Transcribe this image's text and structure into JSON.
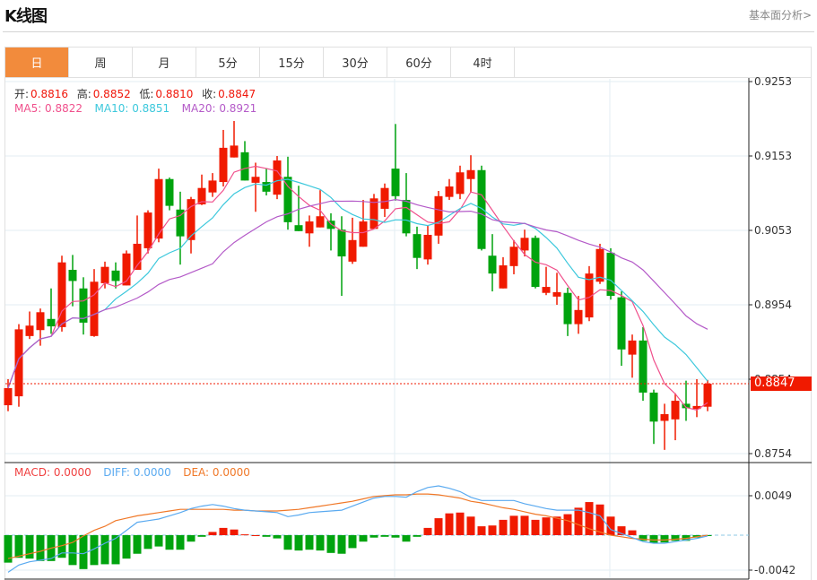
{
  "header": {
    "title": "K线图",
    "more_link": "基本面分析>"
  },
  "tabs": [
    {
      "label": "日",
      "active": true
    },
    {
      "label": "周"
    },
    {
      "label": "月"
    },
    {
      "label": "5分"
    },
    {
      "label": "15分"
    },
    {
      "label": "30分"
    },
    {
      "label": "60分"
    },
    {
      "label": "4时"
    }
  ],
  "ohlc_info": {
    "open_label": "开:",
    "open": "0.8816",
    "high_label": "高:",
    "high": "0.8852",
    "low_label": "低:",
    "low": "0.8810",
    "close_label": "收:",
    "close": "0.8847"
  },
  "ma_info": {
    "ma5": "MA5: 0.8822",
    "ma10": "MA10: 0.8851",
    "ma20": "MA20: 0.8921"
  },
  "macd_info": {
    "macd": "MACD: 0.0000",
    "diff": "DIFF: 0.0000",
    "dea": "DEA: 0.0000"
  },
  "colors": {
    "up": "#f01a00",
    "down": "#00a30e",
    "ma5": "#f0508c",
    "ma10": "#3cc8dc",
    "ma20": "#b45ac8",
    "diff": "#5aaaf0",
    "dea": "#f07828",
    "accent": "#f28b3c"
  },
  "price_axis": {
    "ticks": [
      "0.9253",
      "0.9153",
      "0.9053",
      "0.8954",
      "0.8854",
      "0.8754"
    ],
    "current": "0.8847"
  },
  "macd_axis": {
    "ticks": [
      "0.0049",
      "-0.0042"
    ]
  },
  "chart_data": {
    "type": "candlestick",
    "price_range": [
      0.8754,
      0.9253
    ],
    "macd_range": [
      -0.0042,
      0.0049
    ],
    "candles": [
      [
        0.8818,
        0.8853,
        0.881,
        0.8841
      ],
      [
        0.883,
        0.8927,
        0.8816,
        0.892
      ],
      [
        0.8911,
        0.8944,
        0.8907,
        0.8925
      ],
      [
        0.8919,
        0.8948,
        0.8898,
        0.8943
      ],
      [
        0.8934,
        0.8975,
        0.8914,
        0.8924
      ],
      [
        0.8923,
        0.9019,
        0.8917,
        0.901
      ],
      [
        0.9,
        0.902,
        0.8951,
        0.8985
      ],
      [
        0.8975,
        0.899,
        0.8913,
        0.8929
      ],
      [
        0.8911,
        0.9001,
        0.891,
        0.8984
      ],
      [
        0.8982,
        0.9011,
        0.8975,
        0.9004
      ],
      [
        0.8999,
        0.901,
        0.8975,
        0.8985
      ],
      [
        0.8979,
        0.9026,
        0.8979,
        0.9022
      ],
      [
        0.9,
        0.9073,
        0.9,
        0.9035
      ],
      [
        0.9029,
        0.908,
        0.9022,
        0.9077
      ],
      [
        0.9042,
        0.9136,
        0.9037,
        0.9122
      ],
      [
        0.9122,
        0.9124,
        0.908,
        0.9086
      ],
      [
        0.9081,
        0.9105,
        0.9007,
        0.9045
      ],
      [
        0.904,
        0.9098,
        0.9022,
        0.9095
      ],
      [
        0.9088,
        0.9128,
        0.9087,
        0.911
      ],
      [
        0.9104,
        0.913,
        0.9098,
        0.912
      ],
      [
        0.9118,
        0.9188,
        0.9112,
        0.9164
      ],
      [
        0.9151,
        0.92,
        0.9151,
        0.9167
      ],
      [
        0.9158,
        0.9173,
        0.912,
        0.912
      ],
      [
        0.9117,
        0.9144,
        0.9078,
        0.9125
      ],
      [
        0.9118,
        0.9136,
        0.91,
        0.9105
      ],
      [
        0.9101,
        0.9153,
        0.9095,
        0.9147
      ],
      [
        0.9125,
        0.9152,
        0.9054,
        0.9064
      ],
      [
        0.906,
        0.9113,
        0.9052,
        0.9052
      ],
      [
        0.9049,
        0.9073,
        0.9031,
        0.9065
      ],
      [
        0.9057,
        0.9107,
        0.9057,
        0.9072
      ],
      [
        0.9066,
        0.9076,
        0.9026,
        0.9055
      ],
      [
        0.9054,
        0.9072,
        0.8965,
        0.9018
      ],
      [
        0.9011,
        0.907,
        0.9008,
        0.904
      ],
      [
        0.9031,
        0.9094,
        0.9031,
        0.9065
      ],
      [
        0.9055,
        0.9102,
        0.9055,
        0.9096
      ],
      [
        0.9082,
        0.9116,
        0.9071,
        0.911
      ],
      [
        0.9136,
        0.9196,
        0.9093,
        0.9099
      ],
      [
        0.9094,
        0.913,
        0.9045,
        0.9049
      ],
      [
        0.9048,
        0.9058,
        0.9001,
        0.9016
      ],
      [
        0.9014,
        0.906,
        0.9007,
        0.9047
      ],
      [
        0.9046,
        0.9106,
        0.9035,
        0.9099
      ],
      [
        0.9098,
        0.9122,
        0.9094,
        0.9112
      ],
      [
        0.9102,
        0.914,
        0.9095,
        0.9131
      ],
      [
        0.9122,
        0.9154,
        0.9104,
        0.9134
      ],
      [
        0.9134,
        0.914,
        0.9026,
        0.9028
      ],
      [
        0.9019,
        0.9048,
        0.8971,
        0.8995
      ],
      [
        0.8975,
        0.9017,
        0.8975,
        0.9006
      ],
      [
        0.9005,
        0.904,
        0.8994,
        0.9031
      ],
      [
        0.9026,
        0.9054,
        0.9018,
        0.9043
      ],
      [
        0.9043,
        0.9046,
        0.8975,
        0.8977
      ],
      [
        0.8969,
        0.9004,
        0.8966,
        0.8977
      ],
      [
        0.8964,
        0.8996,
        0.8953,
        0.897
      ],
      [
        0.8969,
        0.8976,
        0.8911,
        0.8927
      ],
      [
        0.8927,
        0.8965,
        0.8914,
        0.8946
      ],
      [
        0.8936,
        0.9005,
        0.8931,
        0.8995
      ],
      [
        0.8984,
        0.9035,
        0.8981,
        0.9028
      ],
      [
        0.9023,
        0.9029,
        0.896,
        0.8965
      ],
      [
        0.8963,
        0.8971,
        0.8871,
        0.8893
      ],
      [
        0.8886,
        0.8913,
        0.8855,
        0.8905
      ],
      [
        0.8905,
        0.8923,
        0.8824,
        0.8835
      ],
      [
        0.8835,
        0.8839,
        0.8766,
        0.8796
      ],
      [
        0.8797,
        0.882,
        0.8758,
        0.8806
      ],
      [
        0.8799,
        0.8834,
        0.8771,
        0.8824
      ],
      [
        0.882,
        0.8851,
        0.8797,
        0.8814
      ],
      [
        0.8813,
        0.8853,
        0.8802,
        0.8817
      ],
      [
        0.8816,
        0.8852,
        0.881,
        0.8847
      ]
    ],
    "macd_hist": [
      -0.0034,
      -0.0028,
      -0.0029,
      -0.0032,
      -0.0032,
      -0.0028,
      -0.0037,
      -0.0042,
      -0.0037,
      -0.0036,
      -0.0036,
      -0.0029,
      -0.0023,
      -0.0017,
      -0.0014,
      -0.0018,
      -0.0018,
      -0.0008,
      -0.0002,
      0.0004,
      0.0009,
      0.0007,
      0.0001,
      0.0,
      -0.0002,
      -0.0004,
      -0.0018,
      -0.0019,
      -0.0018,
      -0.0019,
      -0.0022,
      -0.0023,
      -0.0016,
      -0.0008,
      -0.0003,
      -0.0002,
      -0.0003,
      -0.0008,
      -0.0002,
      0.0009,
      0.0021,
      0.0027,
      0.0028,
      0.0023,
      0.0011,
      0.0012,
      0.0019,
      0.0024,
      0.0024,
      0.0019,
      0.0022,
      0.0023,
      0.0026,
      0.0034,
      0.0041,
      0.0038,
      0.0023,
      0.0011,
      0.0006,
      -0.0007,
      -0.001,
      -0.0009,
      -0.0007,
      -0.0007,
      -0.0003,
      -0.0001
    ],
    "diff": [
      -0.0046,
      -0.0037,
      -0.0033,
      -0.0031,
      -0.0029,
      -0.0022,
      -0.0022,
      -0.0023,
      -0.0017,
      -0.001,
      -0.0004,
      0.0006,
      0.0016,
      0.0018,
      0.002,
      0.0024,
      0.0028,
      0.0033,
      0.0036,
      0.0038,
      0.0036,
      0.0033,
      0.0031,
      0.003,
      0.0029,
      0.0028,
      0.0023,
      0.0025,
      0.0028,
      0.0029,
      0.003,
      0.0031,
      0.0036,
      0.0041,
      0.0046,
      0.0048,
      0.0048,
      0.0047,
      0.0054,
      0.0059,
      0.0061,
      0.0058,
      0.0054,
      0.0047,
      0.0043,
      0.0043,
      0.0043,
      0.0043,
      0.0039,
      0.0036,
      0.0033,
      0.0031,
      0.0031,
      0.0031,
      0.0028,
      0.0024,
      0.0007,
      0.0002,
      -0.0003,
      -0.0008,
      -0.001,
      -0.001,
      -0.0008,
      -0.0006,
      -0.0004,
      -0.0001
    ],
    "dea": [
      -0.0029,
      -0.0026,
      -0.0023,
      -0.002,
      -0.0016,
      -0.0013,
      -0.0009,
      -0.0001,
      0.0006,
      0.0011,
      0.0018,
      0.0021,
      0.0024,
      0.0026,
      0.0028,
      0.003,
      0.0032,
      0.0032,
      0.0032,
      0.0032,
      0.0032,
      0.0031,
      0.0031,
      0.003,
      0.003,
      0.003,
      0.0031,
      0.0032,
      0.0034,
      0.0036,
      0.0038,
      0.004,
      0.0042,
      0.0045,
      0.0048,
      0.0049,
      0.005,
      0.005,
      0.0051,
      0.0051,
      0.005,
      0.0048,
      0.0046,
      0.0042,
      0.004,
      0.0037,
      0.0034,
      0.0032,
      0.0029,
      0.0026,
      0.0024,
      0.0021,
      0.0018,
      0.0013,
      0.0008,
      0.0004,
      0.0,
      -0.0002,
      -0.0004,
      -0.0005,
      -0.0006,
      -0.0006,
      -0.0005,
      -0.0004,
      -0.0002,
      0.0
    ]
  }
}
